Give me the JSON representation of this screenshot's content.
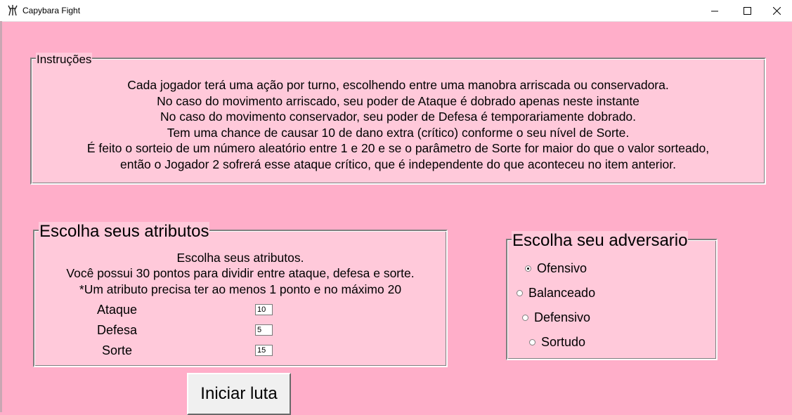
{
  "window": {
    "title": "Capybara Fight",
    "controls": {
      "minimize_icon": "minimize-icon",
      "maximize_icon": "maximize-icon",
      "close_icon": "close-icon"
    }
  },
  "instructions": {
    "legend": "Instruções",
    "lines": [
      "Cada jogador terá uma ação por turno, escolhendo entre uma manobra arriscada ou conservadora.",
      "No caso do movimento arriscado, seu poder de Ataque é dobrado apenas neste instante",
      "No caso do movimento conservador, seu poder de Defesa é temporariamente dobrado.",
      "Tem uma chance de causar 10 de dano extra (crítico) conforme o seu nível de Sorte.",
      "É feito o sorteio de um número aleatório entre 1 e 20 e se o parâmetro de Sorte for maior do que o valor sorteado,",
      "então o Jogador 2 sofrerá esse ataque crítico, que é independente do que aconteceu no item anterior."
    ]
  },
  "attributes": {
    "legend": "Escolha seus atributos",
    "lines": [
      "Escolha seus atributos.",
      "Você possui 30 pontos para dividir entre ataque, defesa e sorte.",
      "*Um atributo precisa ter ao menos 1 ponto e no máximo 20"
    ],
    "fields": [
      {
        "label": "Ataque",
        "value": "10"
      },
      {
        "label": "Defesa",
        "value": "5"
      },
      {
        "label": "Sorte",
        "value": "15"
      }
    ]
  },
  "opponent": {
    "legend": "Escolha seu adversario",
    "options": [
      {
        "label": "Ofensivo",
        "checked": true
      },
      {
        "label": "Balanceado",
        "checked": false
      },
      {
        "label": "Defensivo",
        "checked": false
      },
      {
        "label": "Sortudo",
        "checked": false
      }
    ]
  },
  "start_button": {
    "label": "Iniciar luta"
  },
  "colors": {
    "background": "#ffaec9",
    "panel": "#ffc9da"
  }
}
